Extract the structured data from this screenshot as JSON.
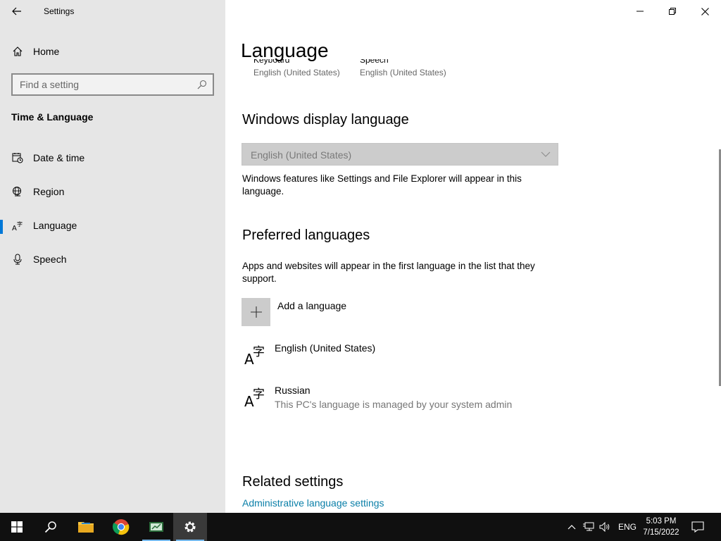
{
  "window": {
    "title": "Settings"
  },
  "sidebar": {
    "home_label": "Home",
    "search_placeholder": "Find a setting",
    "section_heading": "Time & Language",
    "items": [
      {
        "label": "Date & time",
        "icon": "calendar-clock-icon",
        "active": false
      },
      {
        "label": "Region",
        "icon": "globe-icon",
        "active": false
      },
      {
        "label": "Language",
        "icon": "language-icon",
        "active": true
      },
      {
        "label": "Speech",
        "icon": "microphone-icon",
        "active": false
      }
    ]
  },
  "main": {
    "page_title": "Language",
    "shortcuts": [
      {
        "name": "Keyboard",
        "value": "English (United States)"
      },
      {
        "name": "Speech",
        "value": "English (United States)"
      }
    ],
    "display_language": {
      "heading": "Windows display language",
      "selected": "English (United States)",
      "description": "Windows features like Settings and File Explorer will appear in this language."
    },
    "preferred": {
      "heading": "Preferred languages",
      "description": "Apps and websites will appear in the first language in the list that they support.",
      "add_label": "Add a language",
      "languages": [
        {
          "name": "English (United States)",
          "sub": ""
        },
        {
          "name": "Russian",
          "sub": "This PC's language is managed by your system admin"
        }
      ]
    },
    "related": {
      "heading": "Related settings",
      "link": "Administrative language settings"
    }
  },
  "taskbar": {
    "apps": [
      "start",
      "search",
      "file-explorer",
      "chrome",
      "presentation-app",
      "settings"
    ],
    "lang": "ENG",
    "time": "5:03 PM",
    "date": "7/15/2022"
  },
  "colors": {
    "accent": "#0078d7",
    "link": "#0a7fa8",
    "sidebar_bg": "#e6e6e6",
    "taskbar_bg": "#101010"
  }
}
